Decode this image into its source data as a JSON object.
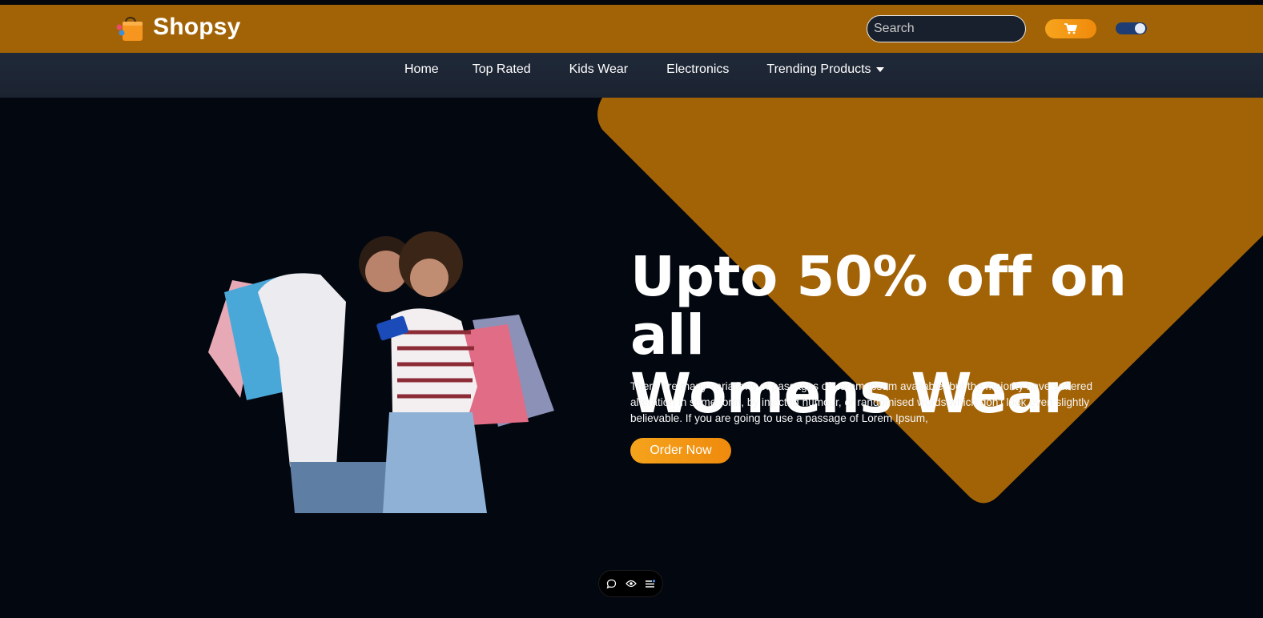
{
  "brand": {
    "name": "Shopsy",
    "accent": "#a26306",
    "button_color": "#f5a31c",
    "background": "#03070f"
  },
  "header": {
    "search_placeholder": "Search",
    "cart_icon": "cart-icon",
    "theme_toggle_icon": "dark-mode-toggle"
  },
  "nav": {
    "items": [
      {
        "label": "Home"
      },
      {
        "label": "Top Rated"
      },
      {
        "label": "Kids Wear"
      },
      {
        "label": "Electronics"
      },
      {
        "label": "Trending Products",
        "icon": "caret-down-icon"
      }
    ]
  },
  "hero": {
    "headline_line1": "Upto 50% off on all",
    "headline_line2": "Womens Wear",
    "description": "There are many variations of passages of Lorem Ipsum available, but the majority have suffered alteration in some form, by injected humour, or randomised words which don't look even slightly believable. If you are going to use a passage of Lorem Ipsum,",
    "cta_label": "Order Now",
    "image": "couple-with-shopping-bags"
  },
  "floating_toolbar": {
    "icons": [
      "comment-icon",
      "eye-icon",
      "menu-icon"
    ]
  }
}
